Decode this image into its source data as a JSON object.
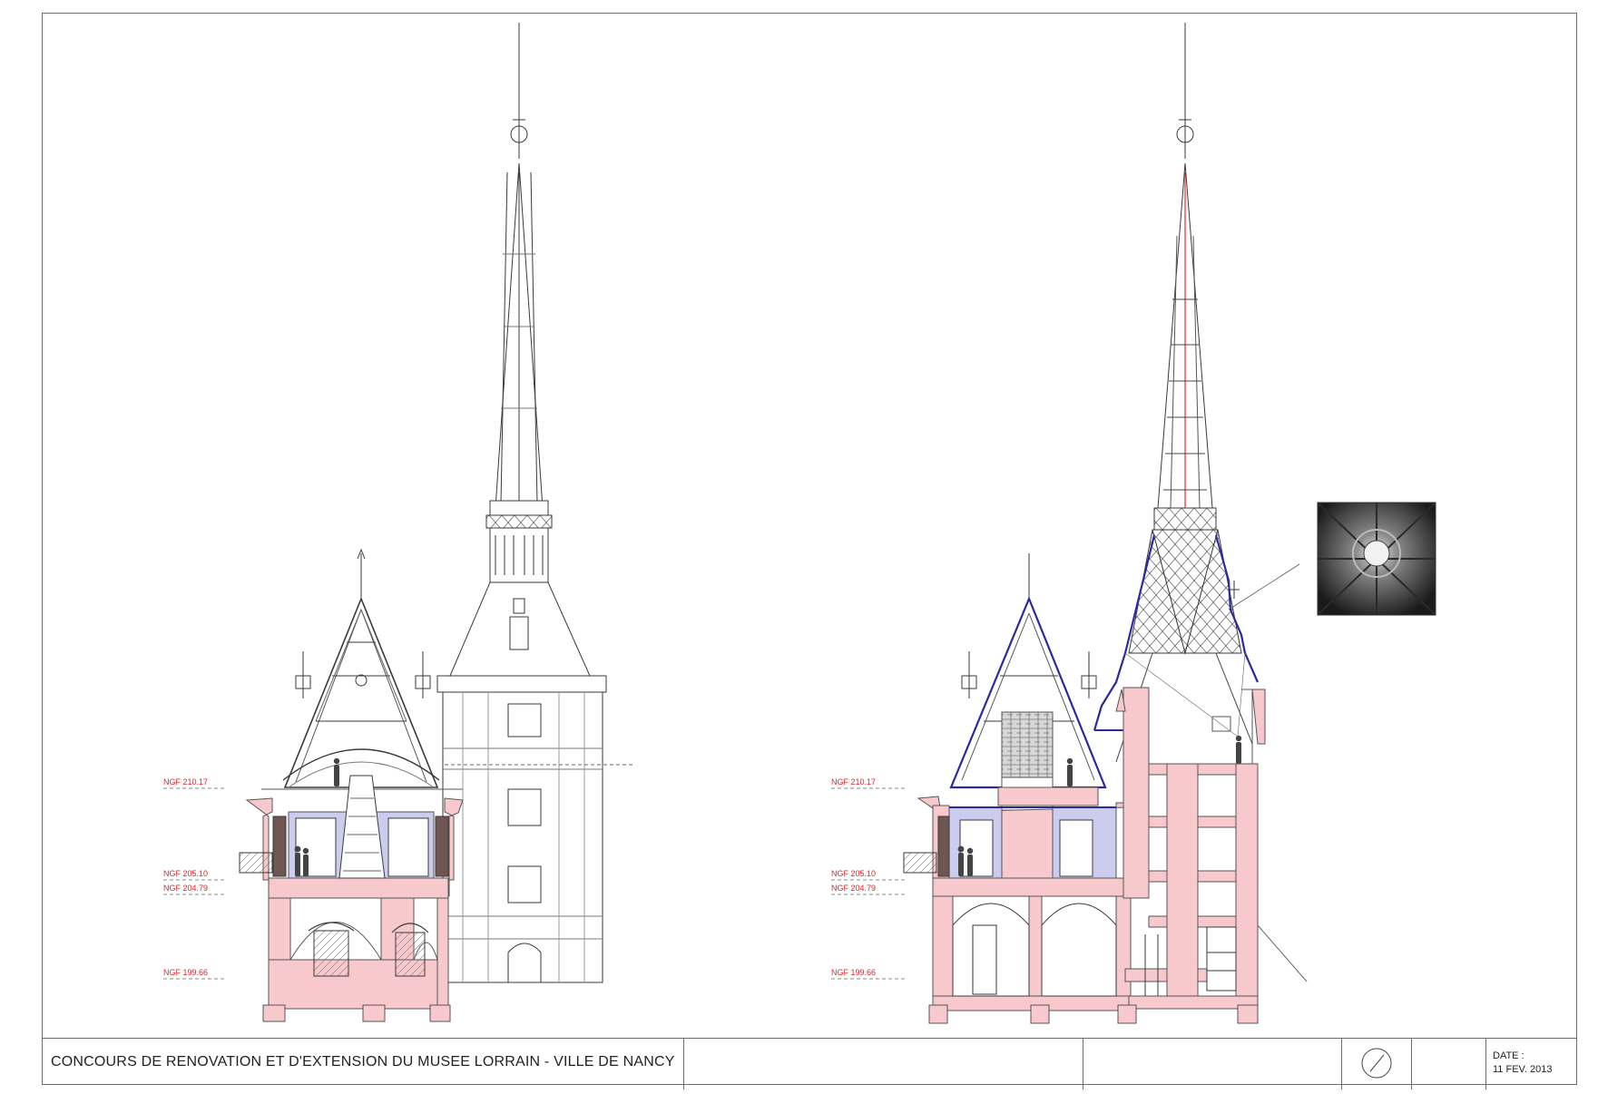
{
  "title_block": {
    "project_title": "CONCOURS DE RENOVATION ET D'EXTENSION DU MUSEE LORRAIN - VILLE DE NANCY",
    "date_label": "DATE :",
    "date_value": "11 FEV. 2013",
    "north_symbol": "north-arrow-icon"
  },
  "left_section": {
    "levels": [
      "NGF 210.17",
      "NGF 205.10",
      "NGF 204.79",
      "NGF 199.66"
    ]
  },
  "right_section": {
    "levels": [
      "NGF 210.17",
      "NGF 205.10",
      "NGF 204.79",
      "NGF 199.66"
    ],
    "photo_inset": "spire-interior-photo"
  },
  "colors": {
    "section_cut": "#f7c9cc",
    "gallery_fill": "#ccccee",
    "level_text": "#e3222c",
    "new_roof_line": "#2a2aa0",
    "line": "#3a3a3a",
    "frame": "#6b6b6b"
  }
}
